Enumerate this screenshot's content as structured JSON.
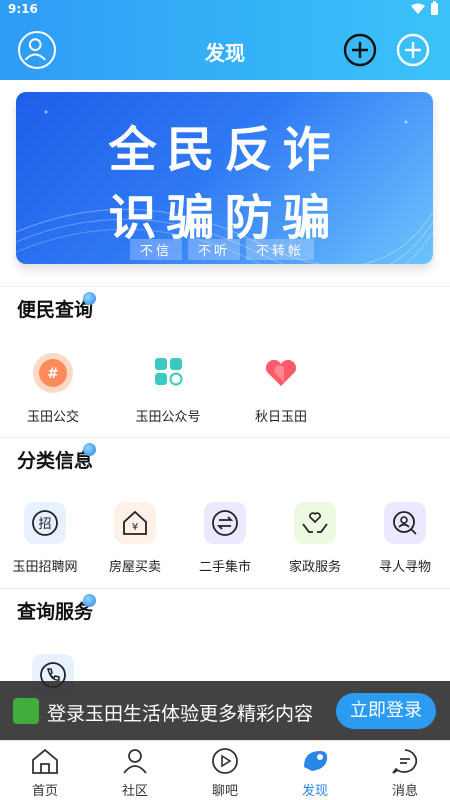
{
  "status_bar": {
    "time": "9:16"
  },
  "header": {
    "title": "发现"
  },
  "banner": {
    "line1": "全民反诈",
    "line2": "识骗防骗",
    "tags": [
      "不信",
      "不听",
      "不转帐"
    ]
  },
  "sections": [
    {
      "title": "便民查询",
      "items": [
        {
          "label": "玉田公交",
          "icon": "bus-icon"
        },
        {
          "label": "玉田公众号",
          "icon": "apps-icon"
        },
        {
          "label": "秋日玉田",
          "icon": "heart-icon"
        }
      ]
    },
    {
      "title": "分类信息",
      "items": [
        {
          "label": "玉田招聘网",
          "icon": "recruit-icon"
        },
        {
          "label": "房屋买卖",
          "icon": "house-icon"
        },
        {
          "label": "二手集市",
          "icon": "exchange-icon"
        },
        {
          "label": "家政服务",
          "icon": "care-icon"
        },
        {
          "label": "寻人寻物",
          "icon": "search-person-icon"
        }
      ]
    },
    {
      "title": "查询服务",
      "items": [
        {
          "label": "",
          "icon": "phone-icon"
        }
      ]
    }
  ],
  "login_prompt": {
    "text": "登录玉田生活体验更多精彩内容",
    "button": "立即登录"
  },
  "bottom_nav": [
    {
      "label": "首页",
      "icon": "home-icon"
    },
    {
      "label": "社区",
      "icon": "community-icon"
    },
    {
      "label": "聊吧",
      "icon": "chat-icon"
    },
    {
      "label": "发现",
      "icon": "discover-icon",
      "active": true
    },
    {
      "label": "消息",
      "icon": "message-icon"
    }
  ],
  "colors": {
    "accent": "#2a86e6",
    "header": "#35b4f7"
  }
}
